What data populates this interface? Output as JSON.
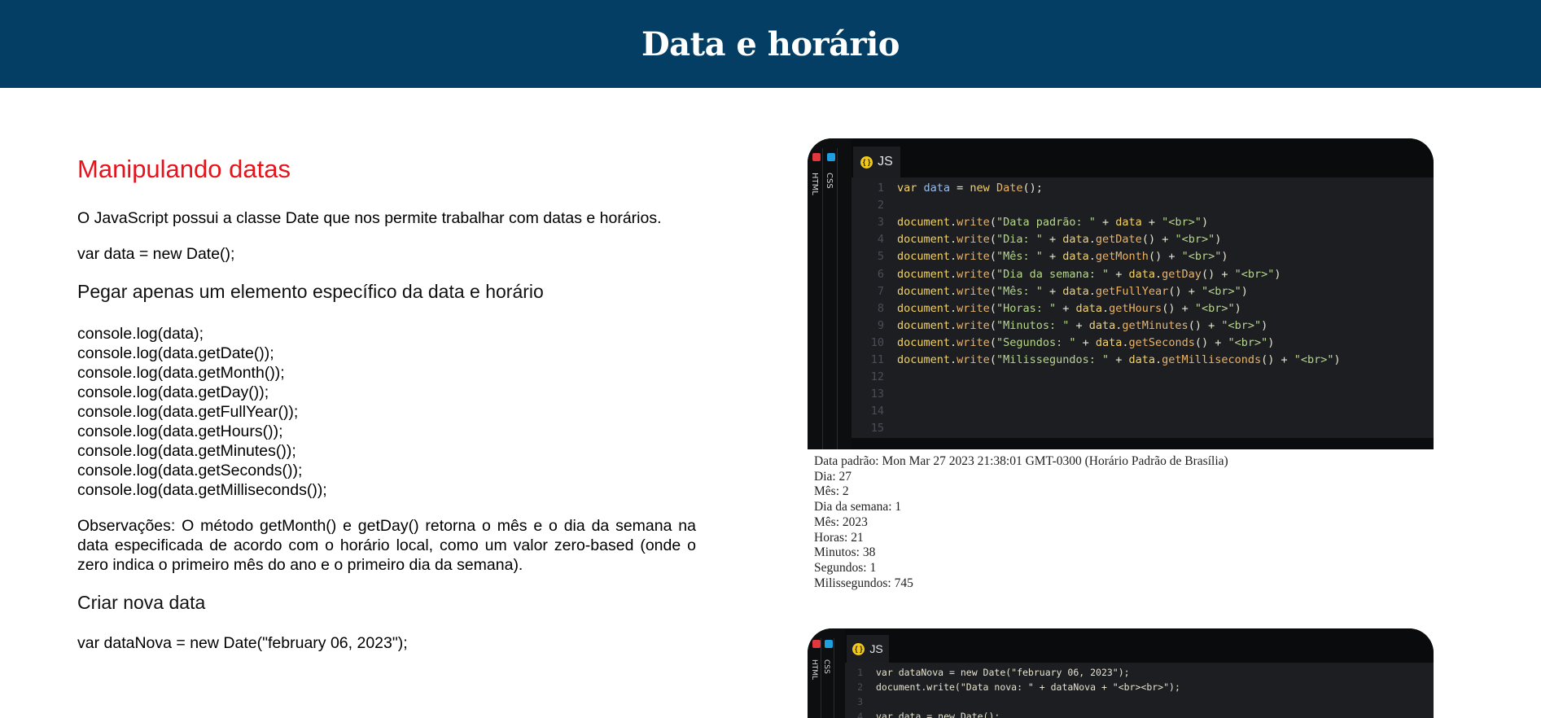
{
  "header": {
    "title": "Data e horário"
  },
  "article": {
    "heading": "Manipulando datas",
    "intro": "O JavaScript possui a classe Date que nos permite trabalhar com datas e horários.",
    "code_new": "var data = new Date();",
    "sub1": "Pegar apenas um elemento específico da data e horário",
    "console_lines": [
      "console.log(data);",
      "console.log(data.getDate());",
      "console.log(data.getMonth());",
      "console.log(data.getDay());",
      "console.log(data.getFullYear());",
      "console.log(data.getHours());",
      "console.log(data.getMinutes());",
      "console.log(data.getSeconds());",
      "console.log(data.getMilliseconds());"
    ],
    "obs": "Observações: O método getMonth() e getDay() retorna o mês e o dia da semana na data especificada de acordo com o horário local, como um valor zero-based (onde o zero indica o primeiro mês do ano e o primeiro dia da semana).",
    "sub2": "Criar nova data",
    "code_new2": "var dataNova = new Date(\"february 06, 2023\");"
  },
  "editor1": {
    "tabs": {
      "html": "HTML",
      "css": "CSS",
      "js": "JS",
      "js_icon": "{ }"
    },
    "lines": [
      {
        "n": "1"
      },
      {
        "n": "2"
      },
      {
        "n": "3"
      },
      {
        "n": "4"
      },
      {
        "n": "5"
      },
      {
        "n": "6"
      },
      {
        "n": "7"
      },
      {
        "n": "8"
      },
      {
        "n": "9"
      },
      {
        "n": "10"
      },
      {
        "n": "11"
      },
      {
        "n": "12"
      },
      {
        "n": "13"
      },
      {
        "n": "14"
      },
      {
        "n": "15"
      }
    ],
    "code": {
      "l1": [
        "var",
        " data",
        " = ",
        "new",
        " Date",
        "();"
      ],
      "write_obj": "document",
      "write_fn": "write",
      "strings": [
        "\"Data padrão: \"",
        "\"Dia: \"",
        "\"Mês: \"",
        "\"Dia da semana: \"",
        "\"Mês: \"",
        "\"Horas: \"",
        "\"Minutos: \"",
        "\"Segundos: \"",
        "\"Milissegundos: \""
      ],
      "getters": [
        "",
        "getDate",
        "getMonth",
        "getDay",
        "getFullYear",
        "getHours",
        "getMinutes",
        "getSeconds",
        "getMilliseconds"
      ],
      "br": "\"<br>\""
    }
  },
  "output": [
    "Data padrão: Mon Mar 27 2023 21:38:01 GMT-0300 (Horário Padrão de Brasília)",
    "Dia: 27",
    "Mês: 2",
    "Dia da semana: 1",
    "Mês: 2023",
    "Horas: 21",
    "Minutos: 38",
    "Segundos: 1",
    "Milissegundos: 745"
  ],
  "editor2": {
    "tabs": {
      "html": "HTML",
      "css": "CSS",
      "js": "JS",
      "js_icon": "{ }"
    },
    "lines": [
      {
        "n": "1",
        "text": "var dataNova = new Date(\"february 06, 2023\");"
      },
      {
        "n": "2",
        "text": "document.write(\"Data nova: \" + dataNova + \"<br><br>\");"
      },
      {
        "n": "3",
        "text": ""
      },
      {
        "n": "4",
        "text": "var data = new Date();"
      }
    ]
  },
  "colors": {
    "header_bg": "#053e64",
    "heading_red": "#e8121b",
    "editor_bg": "#1c1e22"
  }
}
